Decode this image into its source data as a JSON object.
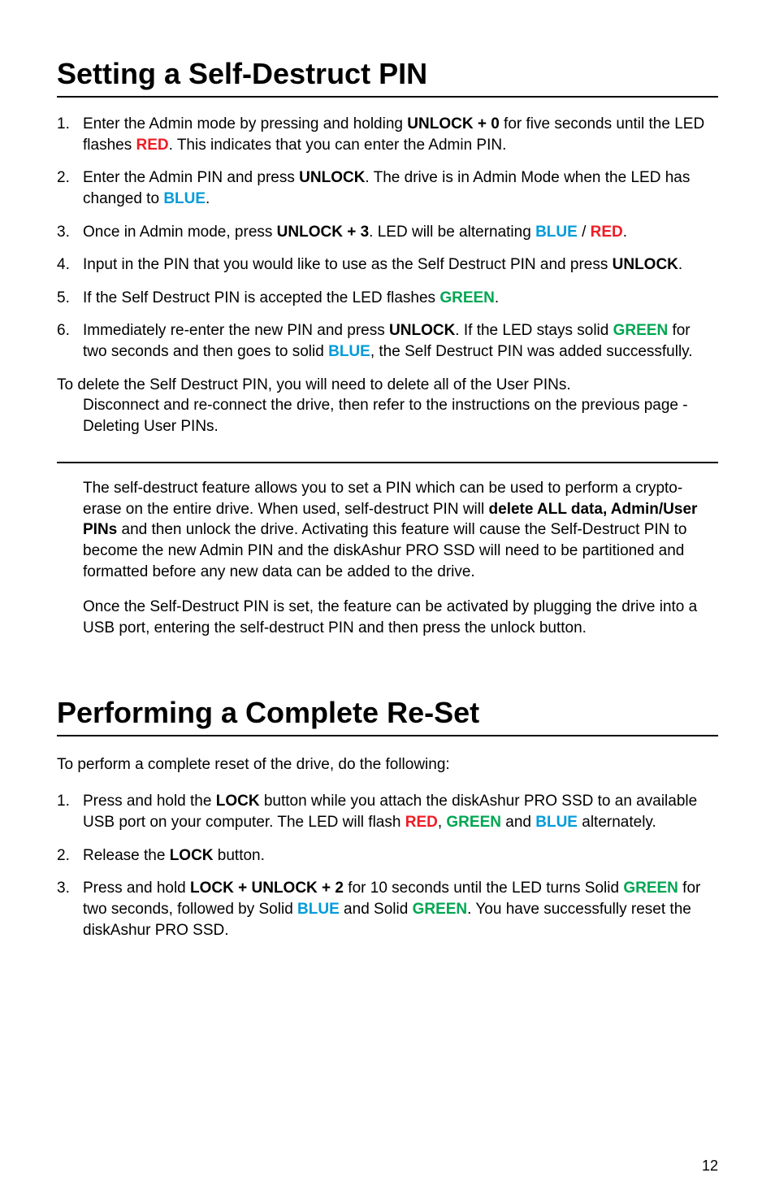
{
  "section1": {
    "title": "Setting a Self-Destruct PIN",
    "items": [
      {
        "num": "1.",
        "parts": [
          {
            "t": "Enter the Admin mode by pressing and holding "
          },
          {
            "t": "UNLOCK + 0",
            "b": true
          },
          {
            "t": " for five seconds until the LED flashes "
          },
          {
            "t": "RED",
            "c": "red"
          },
          {
            "t": ". This indicates that you can enter the Admin PIN."
          }
        ]
      },
      {
        "num": "2.",
        "parts": [
          {
            "t": "Enter the Admin PIN and press "
          },
          {
            "t": "UNLOCK",
            "b": true
          },
          {
            "t": ". The drive is in Admin Mode when the LED has changed to "
          },
          {
            "t": "BLUE",
            "c": "blue"
          },
          {
            "t": "."
          }
        ]
      },
      {
        "num": "3.",
        "parts": [
          {
            "t": "Once in Admin mode, press "
          },
          {
            "t": "UNLOCK + 3",
            "b": true
          },
          {
            "t": ". LED will be alternating "
          },
          {
            "t": "BLUE",
            "c": "blue"
          },
          {
            "t": " / "
          },
          {
            "t": "RED",
            "c": "red"
          },
          {
            "t": "."
          }
        ]
      },
      {
        "num": "4.",
        "parts": [
          {
            "t": "Input in the PIN that you would like to use as the Self Destruct PIN and press "
          },
          {
            "t": "UNLOCK",
            "b": true
          },
          {
            "t": "."
          }
        ]
      },
      {
        "num": "5.",
        "parts": [
          {
            "t": "If the Self Destruct PIN is accepted the LED flashes "
          },
          {
            "t": "GREEN",
            "c": "green"
          },
          {
            "t": "."
          }
        ]
      },
      {
        "num": "6.",
        "parts": [
          {
            "t": "Immediately re-enter the new PIN and press "
          },
          {
            "t": "UNLOCK",
            "b": true
          },
          {
            "t": ". If the LED stays solid "
          },
          {
            "t": "GREEN",
            "c": "green"
          },
          {
            "t": " for two seconds and then goes to solid "
          },
          {
            "t": "BLUE",
            "c": "blue"
          },
          {
            "t": ", the Self Destruct PIN was added successfully."
          }
        ]
      }
    ],
    "delete_lead": "To delete the Self Destruct PIN, you will need to delete all of the User PINs.",
    "delete_hang": "Disconnect and re-connect the drive, then refer to the instructions on the previous page - Deleting User PINs.",
    "para1": [
      {
        "t": "The self-destruct feature allows you to set a PIN which can be used to perform a crypto-erase on the entire drive. When used, self-destruct PIN will "
      },
      {
        "t": "delete ALL data, Admin/User PINs",
        "b": true
      },
      {
        "t": " and then unlock the drive. Activating this feature will cause the Self-Destruct PIN to become the new Admin PIN and the diskAshur PRO SSD will need to be partitioned and formatted before any new data can be added to the drive."
      }
    ],
    "para2": "Once the Self-Destruct PIN is set, the feature can be activated by plugging the drive into a USB port, entering the self-destruct PIN and then press the unlock button."
  },
  "section2": {
    "title": "Performing a Complete Re-Set",
    "intro": "To perform a complete reset of the drive, do the following:",
    "items": [
      {
        "num": "1.",
        "parts": [
          {
            "t": "Press and hold the "
          },
          {
            "t": "LOCK",
            "b": true
          },
          {
            "t": " button while you attach the diskAshur PRO SSD to an available USB port on your computer. The LED will flash "
          },
          {
            "t": "RED",
            "c": "red"
          },
          {
            "t": ", "
          },
          {
            "t": "GREEN",
            "c": "green"
          },
          {
            "t": " and "
          },
          {
            "t": "BLUE",
            "c": "blue"
          },
          {
            "t": " alternately."
          }
        ]
      },
      {
        "num": "2.",
        "parts": [
          {
            "t": "Release the "
          },
          {
            "t": "LOCK",
            "b": true
          },
          {
            "t": " button."
          }
        ]
      },
      {
        "num": "3.",
        "parts": [
          {
            "t": "Press and hold "
          },
          {
            "t": "LOCK + UNLOCK + 2",
            "b": true
          },
          {
            "t": " for 10 seconds until the LED turns Solid "
          },
          {
            "t": "GREEN",
            "c": "green"
          },
          {
            "t": " for two seconds, followed by Solid "
          },
          {
            "t": "BLUE",
            "c": "blue"
          },
          {
            "t": " and Solid "
          },
          {
            "t": "GREEN",
            "c": "green"
          },
          {
            "t": ". You have successfully reset the diskAshur PRO SSD."
          }
        ]
      }
    ]
  },
  "pagenum": "12"
}
